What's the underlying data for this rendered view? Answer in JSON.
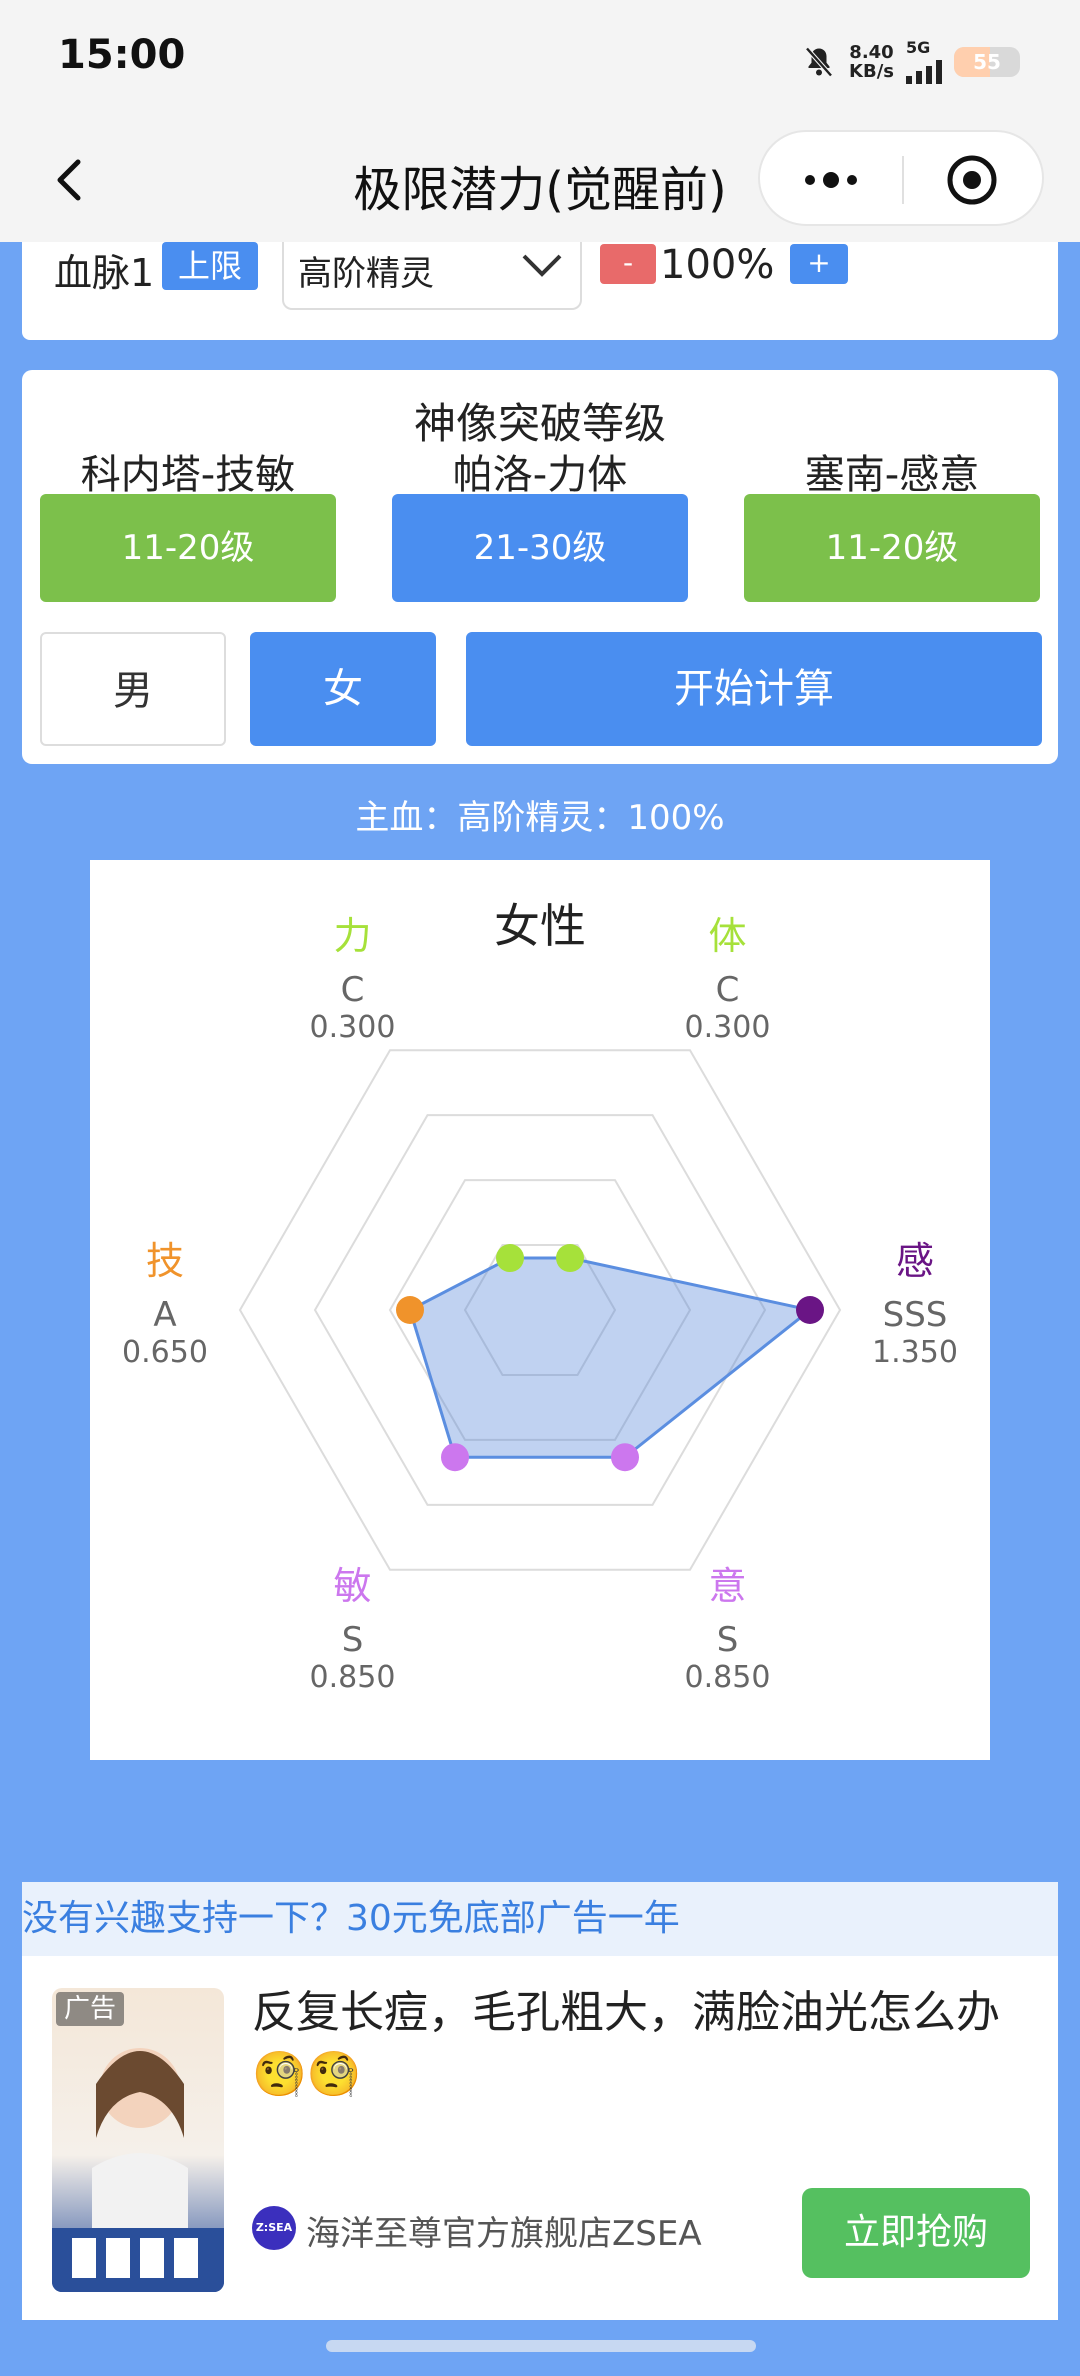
{
  "status": {
    "time": "15:00",
    "net_speed_value": "8.40",
    "net_speed_unit": "KB/s",
    "network": "5G",
    "battery": "55",
    "battery_level": 0.55
  },
  "nav": {
    "title": "极限潜力(觉醒前)"
  },
  "bloodline": {
    "label": "血脉1",
    "limit_label": "上限",
    "selected": "高阶精灵",
    "minus": "-",
    "percent": "100%",
    "plus": "+"
  },
  "breakthrough": {
    "title": "神像突破等级",
    "gods": [
      {
        "name": "科内塔-技敏",
        "level": "11-20级"
      },
      {
        "name": "帕洛-力体",
        "level": "21-30级"
      },
      {
        "name": "塞南-感意",
        "level": "11-20级"
      }
    ],
    "male_label": "男",
    "female_label": "女",
    "calc_label": "开始计算"
  },
  "main_blood_text": "主血：高阶精灵：100%",
  "chart_data": {
    "type": "radar",
    "title": "女性",
    "axes": [
      {
        "name": "力",
        "grade": "C",
        "value": 0.3,
        "color": "#a6e13a"
      },
      {
        "name": "体",
        "grade": "C",
        "value": 0.3,
        "color": "#a6e13a"
      },
      {
        "name": "感",
        "grade": "SSS",
        "value": 1.35,
        "color": "#6a1585"
      },
      {
        "name": "意",
        "grade": "S",
        "value": 0.85,
        "color": "#cc77ee"
      },
      {
        "name": "敏",
        "grade": "S",
        "value": 0.85,
        "color": "#cc77ee"
      },
      {
        "name": "技",
        "grade": "A",
        "value": 0.65,
        "color": "#f0932b"
      }
    ],
    "value_labels": [
      "0.300",
      "0.300",
      "1.350",
      "0.850",
      "0.850",
      "0.650"
    ],
    "max": 1.5,
    "rings": 4,
    "fill_color": "#4a7fd6",
    "line_color": "#5b8ee0"
  },
  "ad": {
    "support_text": "没有兴趣支持一下？30元免底部广告一年",
    "badge": "广告",
    "headline": "反复长痘，毛孔粗大，满脸油光怎么办",
    "emoji": "🧐🧐",
    "shop_icon": "Z:SEA",
    "shop": "海洋至尊官方旗舰店ZSEA",
    "buy": "立即抢购"
  }
}
